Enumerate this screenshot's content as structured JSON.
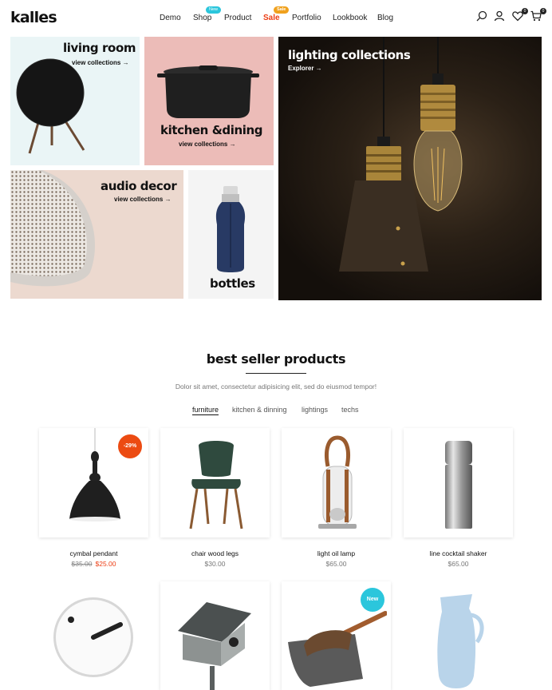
{
  "brand": {
    "logo": "kalles"
  },
  "nav": {
    "items": [
      {
        "label": "Demo"
      },
      {
        "label": "Shop",
        "badge": "New"
      },
      {
        "label": "Product"
      },
      {
        "label": "Sale",
        "badge": "Sale"
      },
      {
        "label": "Portfolio"
      },
      {
        "label": "Lookbook"
      },
      {
        "label": "Blog"
      }
    ]
  },
  "header_icons": {
    "search": "search-icon",
    "account": "user-icon",
    "wishlist": {
      "icon": "heart-icon",
      "count": "0"
    },
    "cart": {
      "icon": "cart-icon",
      "count": "0"
    }
  },
  "collections": [
    {
      "title": "living room",
      "link": "view collections →"
    },
    {
      "title": "kitchen &dining",
      "link": "view collections →"
    },
    {
      "title": "lighting collections",
      "link": "Explorer →"
    },
    {
      "title": "audio decor",
      "link": "view collections →"
    },
    {
      "title": "bottles"
    }
  ],
  "best_sellers": {
    "title": "best seller products",
    "subtitle": "Dolor sit amet, consectetur adipisicing elit, sed do eiusmod tempor!",
    "tabs": [
      "furniture",
      "kitchen & dinning",
      "lightings",
      "techs"
    ],
    "active_tab": "furniture",
    "products": [
      {
        "name": "cymbal pendant",
        "old_price": "$35.00",
        "price": "$25.00",
        "badge": "-29%"
      },
      {
        "name": "chair wood legs",
        "price": "$30.00"
      },
      {
        "name": "light oil lamp",
        "price": "$65.00"
      },
      {
        "name": "line cocktail shaker",
        "price": "$65.00"
      },
      {
        "name": "",
        "price": ""
      },
      {
        "name": "",
        "price": ""
      },
      {
        "name": "",
        "price": "",
        "badge": "New"
      },
      {
        "name": "",
        "price": ""
      }
    ]
  },
  "colors": {
    "new_badge": "#2bc6dc",
    "sale_badge_nav": "#f0a11d",
    "sale_text": "#ec3d13",
    "discount_badge": "#ec4b12",
    "tile_living": "#eaf5f6",
    "tile_kitchen": "#ecbcb8",
    "tile_audio": "#ecd9cf",
    "tile_bottles": "#f4f4f4",
    "tile_lighting": "#1e1812"
  }
}
